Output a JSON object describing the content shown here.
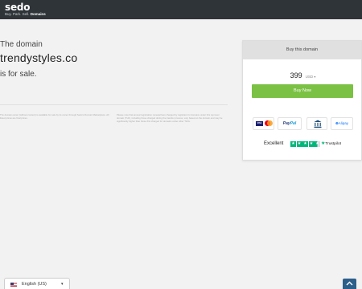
{
  "header": {
    "logo_text": "sedo",
    "tagline_prefix": "Buy. Park. Sell.",
    "tagline_bold": "Domains"
  },
  "hero": {
    "intro": "The domain",
    "domain": "trendystyles.co",
    "suffix": "is for sale."
  },
  "disclaimers": {
    "left": "The domain owner (without content) is available for sale by its owner through Sedo's Domain Marketplace. All listed prices are final prices.",
    "right": "Please note that annual registration renewal fees charged by registrars for domains under this top level domain (TLD), including those charged during the transfer process, vary based on the domain and may be significantly higher than those first charged for domains under other TLDs."
  },
  "card": {
    "header": "Buy this domain",
    "price": "399",
    "currency": "USD",
    "buy_label": "Buy Now",
    "payments": {
      "visa": "VISA",
      "paypal_a": "Pay",
      "paypal_b": "Pal",
      "alipay": "Alipay"
    },
    "trust": {
      "rating_text": "Excellent",
      "brand": "Trustpilot",
      "star_glyph": "★",
      "stars_full": 4,
      "stars_half": 1
    }
  },
  "footer": {
    "language": "English (US)",
    "caret": "▾"
  },
  "colors": {
    "topbar": "#2f3439",
    "buy_button": "#7bc143",
    "trustpilot": "#00b67a",
    "scroll_button": "#2c5f8a"
  }
}
